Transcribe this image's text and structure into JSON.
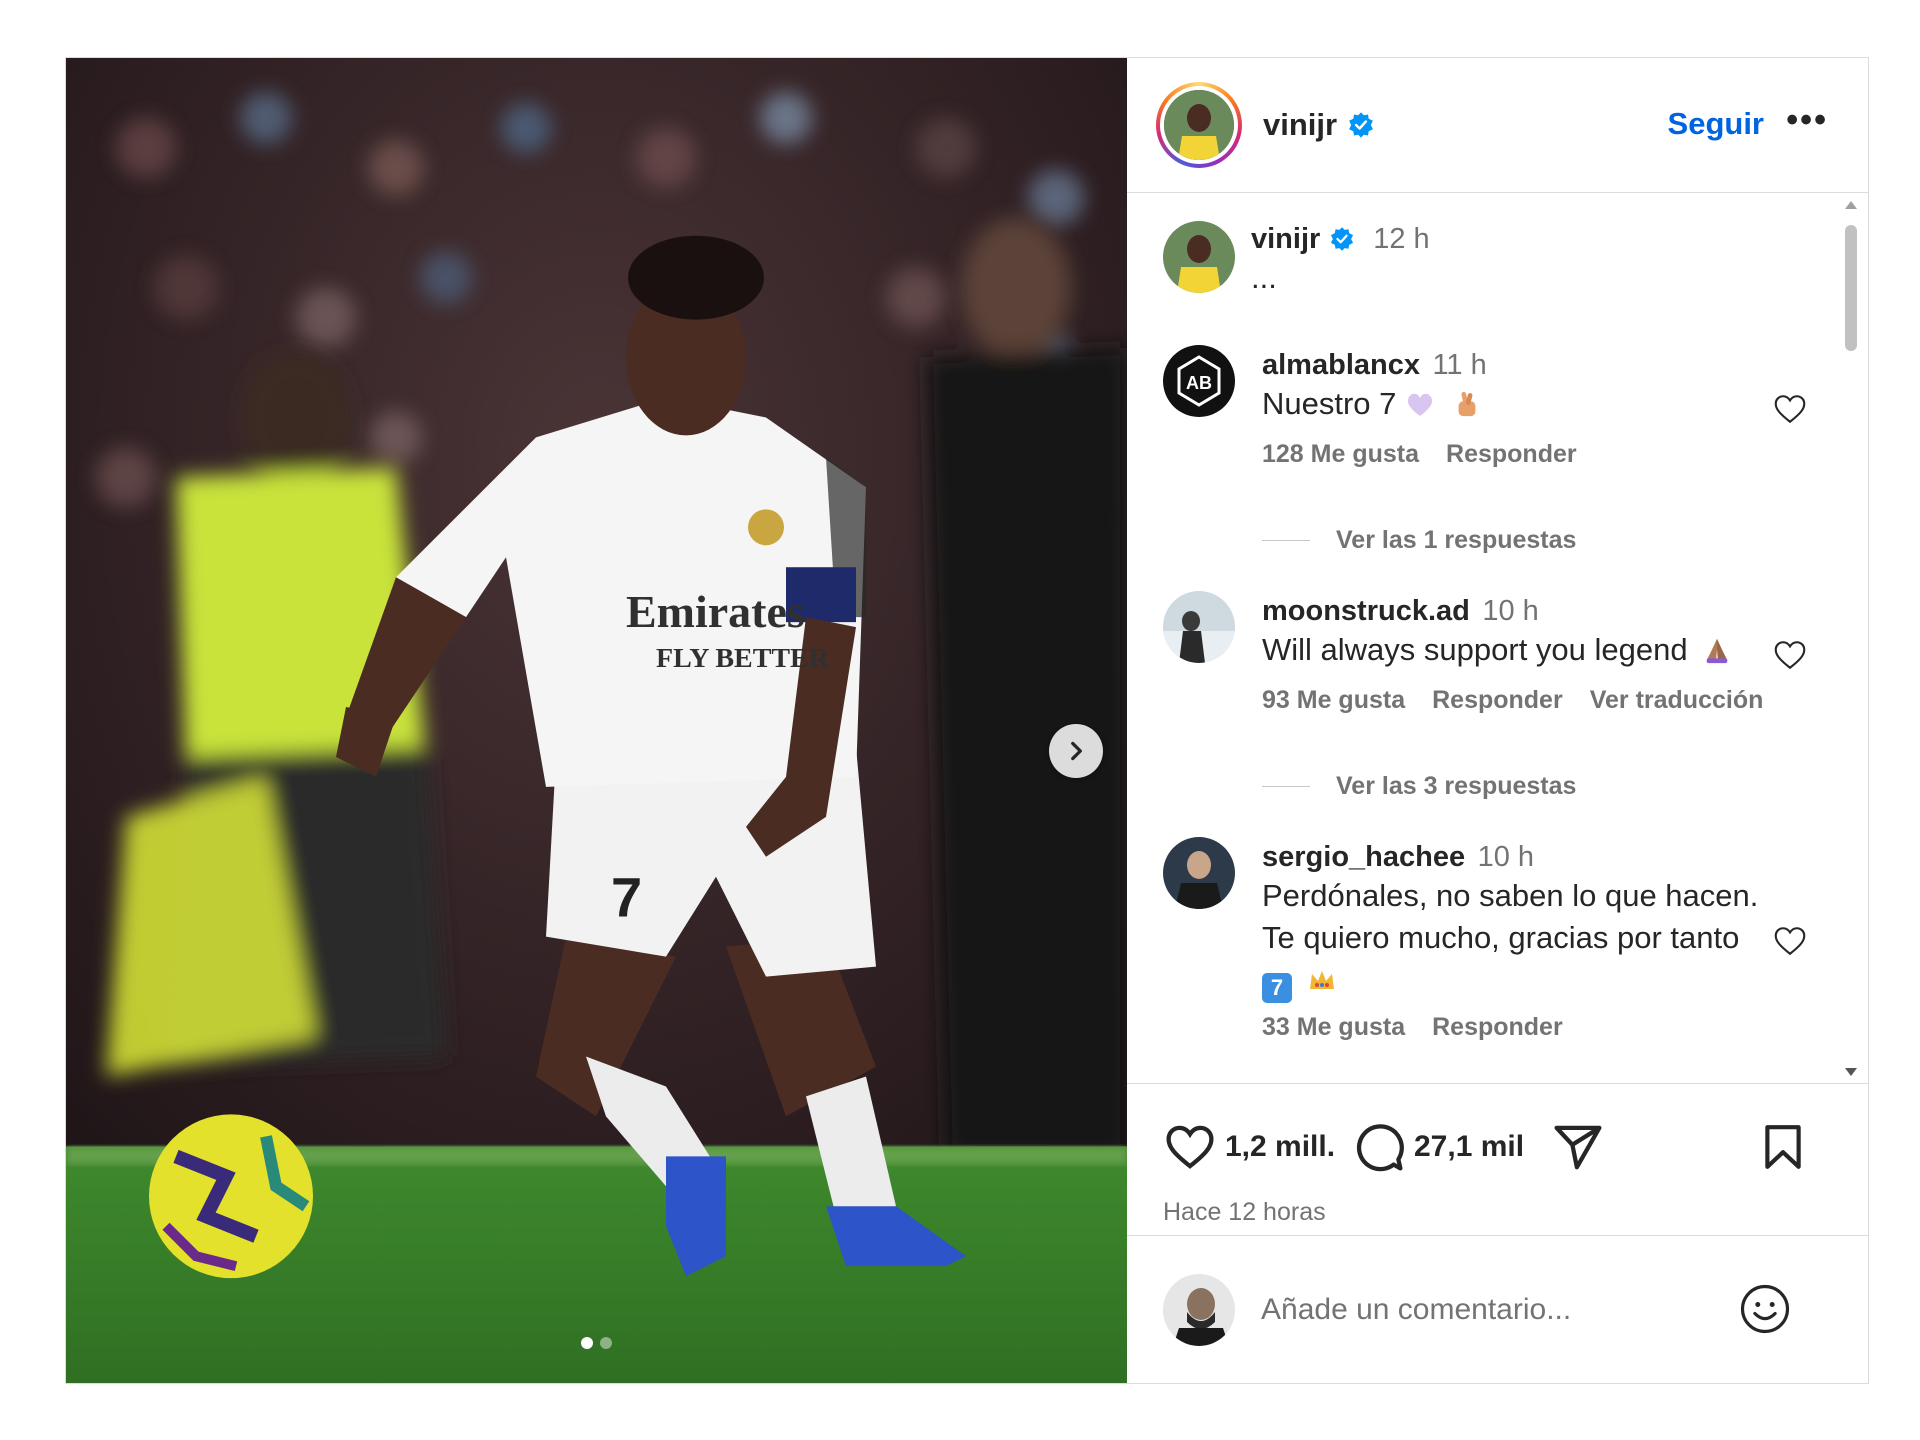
{
  "header": {
    "username": "vinijr",
    "follow_label": "Seguir",
    "more_label": "•••"
  },
  "caption": {
    "username": "vinijr",
    "time": "12 h",
    "text": "..."
  },
  "comments": [
    {
      "username": "almablancx",
      "time": "11 h",
      "text": "Nuestro 7",
      "likes": "128 Me gusta",
      "reply": "Responder",
      "view_replies": "Ver las 1 respuestas",
      "emojis": [
        "purple-heart-emoji",
        "crossed-fingers-emoji"
      ]
    },
    {
      "username": "moonstruck.ad",
      "time": "10 h",
      "text": "Will always support you legend",
      "likes": "93 Me gusta",
      "reply": "Responder",
      "translate": "Ver traducción",
      "view_replies": "Ver las 3 respuestas",
      "emojis": [
        "praying-hands-emoji"
      ]
    },
    {
      "username": "sergio_hachee",
      "time": "10 h",
      "text_line1": "Perdónales, no saben lo que hacen.",
      "text_line2": "Te quiero mucho, gracias por tanto",
      "keycap_text": "7",
      "likes": "33 Me gusta",
      "reply": "Responder",
      "emojis": [
        "keycap-seven-emoji",
        "crown-emoji"
      ]
    }
  ],
  "actions": {
    "likes": "1,2 mill.",
    "comments": "27,1 mil",
    "posted_ago": "Hace 12 horas"
  },
  "add_comment": {
    "placeholder": "Añade un comentario..."
  },
  "carousel": {
    "current_index": 1,
    "total": 2
  },
  "colors": {
    "accent_blue": "#0064e0",
    "verified_blue": "#0095f6",
    "secondary_text": "#737373",
    "border": "#dbdbdb"
  }
}
